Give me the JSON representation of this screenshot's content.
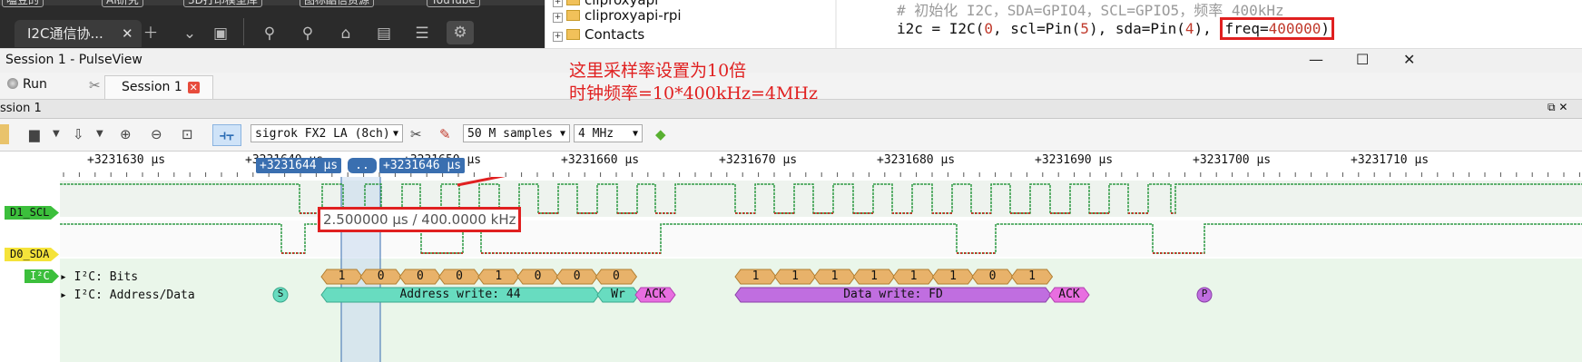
{
  "browser": {
    "bookmark_chips": [
      "嗑豆的",
      "AI研究",
      "3D打印模型库",
      "图标酷信资源",
      "YouTube"
    ],
    "tab_title": "I2C通信协...",
    "tab_close": "✕",
    "icons": [
      "add-icon",
      "chevron-down-icon",
      "sidebar-icon",
      "extension-icon",
      "extension-2-icon",
      "tag-icon",
      "archive-icon",
      "list-icon",
      "robot-icon"
    ]
  },
  "file_tree": {
    "items": [
      "cliproxyapi",
      "cliproxyapi-rpi",
      "Contacts"
    ]
  },
  "code": {
    "comment": "# 初始化 I2C，SDA=GPIO4，SCL=GPIO5，频率 400kHz",
    "line_prefix": "i2c = I2C(",
    "arg0": "0",
    "mid1": ", scl=Pin(",
    "arg_scl": "5",
    "mid2": "), sda=Pin(",
    "arg_sda": "4",
    "mid3": "), ",
    "freq_key": "freq=",
    "freq_val": "400000",
    "close": ")"
  },
  "window": {
    "title": "Session 1 - PulseView",
    "minimize": "—",
    "maximize": "☐",
    "close": "✕"
  },
  "annotation": {
    "line1": "这里采样率设置为10倍",
    "line2": "时钟频率=10*400kHz=4MHz"
  },
  "tabs": {
    "run_label": "Run",
    "session_label": "Session 1",
    "session_close": "✕"
  },
  "session_header": "ssion 1",
  "toolbar": {
    "device": "sigrok FX2 LA (8ch)",
    "samples": "50 M samples",
    "rate": "4 MHz"
  },
  "ruler": {
    "ticks": [
      "+3231630 μs",
      "+3231640 μs",
      "+3231650 μs",
      "+3231660 μs",
      "+3231670 μs",
      "+3231680 μs",
      "+3231690 μs",
      "+3231700 μs",
      "+3231710 μs"
    ],
    "cursor_left": "+3231644 μs",
    "cursor_mid": "..",
    "cursor_right": "+3231646 μs"
  },
  "measurement": "2.500000 μs / 400.0000 kHz",
  "channels": {
    "scl_label": "D1_SCL",
    "sda_label": "D0_SDA",
    "decoder_label": "I²C",
    "bits_row": "I²C: Bits",
    "addr_row": "I²C: Address/Data"
  },
  "colors": {
    "signal_high": "#2e9a44",
    "signal_low": "#c0392b",
    "channel_green": "#3cbf3c",
    "channel_yellow": "#f5e33a",
    "bits_fill": "#e8b26a",
    "addr_fill": "#68dcc0",
    "data_fill": "#c06ee0",
    "ack_fill": "#e86ee0",
    "cursor": "#3a6fb0",
    "annotation_red": "#e02020"
  },
  "decoded": {
    "start": "S",
    "stop": "P",
    "bits_addr": [
      "1",
      "0",
      "0",
      "0",
      "1",
      "0",
      "0",
      "0"
    ],
    "bits_data": [
      "1",
      "1",
      "1",
      "1",
      "1",
      "1",
      "0",
      "1"
    ],
    "address_write": "Address write: 44",
    "wr": "Wr",
    "ack1": "ACK",
    "data_write": "Data write: FD",
    "ack2": "ACK"
  }
}
